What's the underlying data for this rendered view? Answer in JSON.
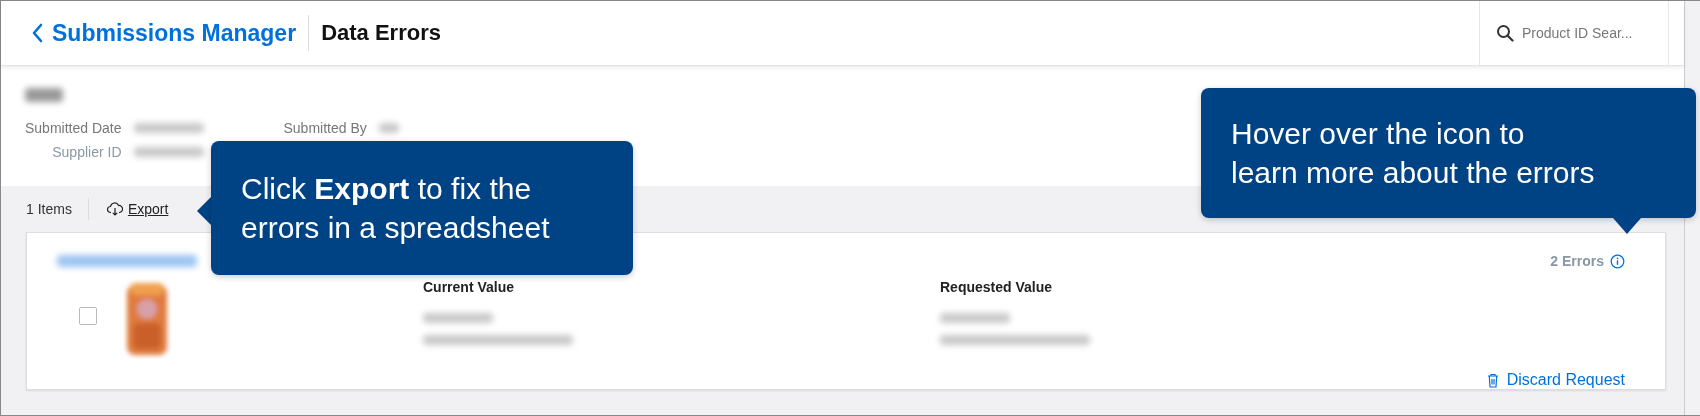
{
  "header": {
    "back_label": "Submissions Manager",
    "title": "Data Errors"
  },
  "search": {
    "placeholder": "Product ID Sear..."
  },
  "details": [
    {
      "label": "Submitted Date"
    },
    {
      "label": "Supplier ID"
    },
    {
      "label": "Submitted By"
    }
  ],
  "toolbar": {
    "count": "1 Items",
    "export": "Export"
  },
  "card": {
    "errors": "2 Errors",
    "checked": false,
    "columns": [
      "Current Value",
      "Requested Value"
    ],
    "discard": "Discard Request"
  },
  "tooltips": [
    {
      "lines": [
        "Click **Export** to fix the",
        "errors in a spreadsheet"
      ],
      "kind": "left"
    },
    {
      "lines": [
        "Hover over the icon to",
        "learn more about the errors"
      ],
      "kind": "down"
    }
  ]
}
